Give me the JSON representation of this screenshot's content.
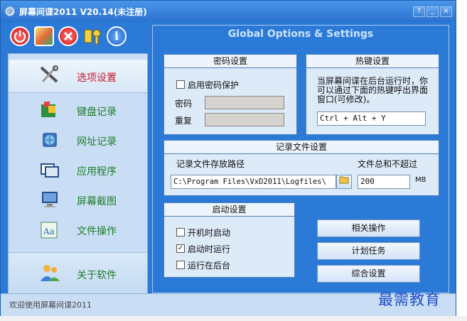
{
  "window": {
    "title": "屏幕间谍2011  V20.14(未注册)",
    "controls": {
      "help": "?",
      "minimize": "_",
      "maximize": "□",
      "close": "×"
    }
  },
  "toolbar": {
    "icons": [
      "power-icon",
      "diamond-icon",
      "close-circle-icon",
      "key-icon",
      "info-icon"
    ],
    "info_glyph": "i"
  },
  "sidebar": {
    "items": [
      {
        "label": "选项设置",
        "icon": "tools-icon"
      },
      {
        "label": "键盘记录",
        "icon": "keyboard-icon"
      },
      {
        "label": "网址记录",
        "icon": "globe-icon"
      },
      {
        "label": "应用程序",
        "icon": "windows-icon"
      },
      {
        "label": "屏幕截图",
        "icon": "monitor-icon"
      },
      {
        "label": "文件操作",
        "icon": "file-icon"
      },
      {
        "label": "关于软件",
        "icon": "users-icon"
      }
    ]
  },
  "main": {
    "title": "Global Options & Settings",
    "password": {
      "header": "密码设置",
      "enable_label": "启用密码保护",
      "enabled": false,
      "password_label": "密码",
      "repeat_label": "重复"
    },
    "hotkey": {
      "header": "热键设置",
      "description": "当屏幕间谍在后台运行时，你可以通过下面的热键呼出界面窗口(可修改)。",
      "value": "Ctrl + Alt + Y"
    },
    "logfile": {
      "header": "记录文件设置",
      "path_label": "记录文件存放路径",
      "path_value": "C:\\Program Files\\VxD2011\\Logfiles\\",
      "size_label": "文件总和不超过",
      "size_value": "200",
      "unit": "MB"
    },
    "startup": {
      "header": "启动设置",
      "options": [
        {
          "label": "开机时启动",
          "checked": false
        },
        {
          "label": "启动时运行",
          "checked": true
        },
        {
          "label": "运行在后台",
          "checked": false
        }
      ]
    },
    "buttons": {
      "related": "相关操作",
      "schedule": "计划任务",
      "general": "综合设置"
    }
  },
  "status": {
    "text": "欢迎使用屏幕间谍2011"
  },
  "watermark": "最需教育",
  "colors": {
    "accent": "#2b7ad8",
    "panel": "#c9def4",
    "selected_label": "#c41c2c",
    "nav_label": "#1f7d2a"
  }
}
